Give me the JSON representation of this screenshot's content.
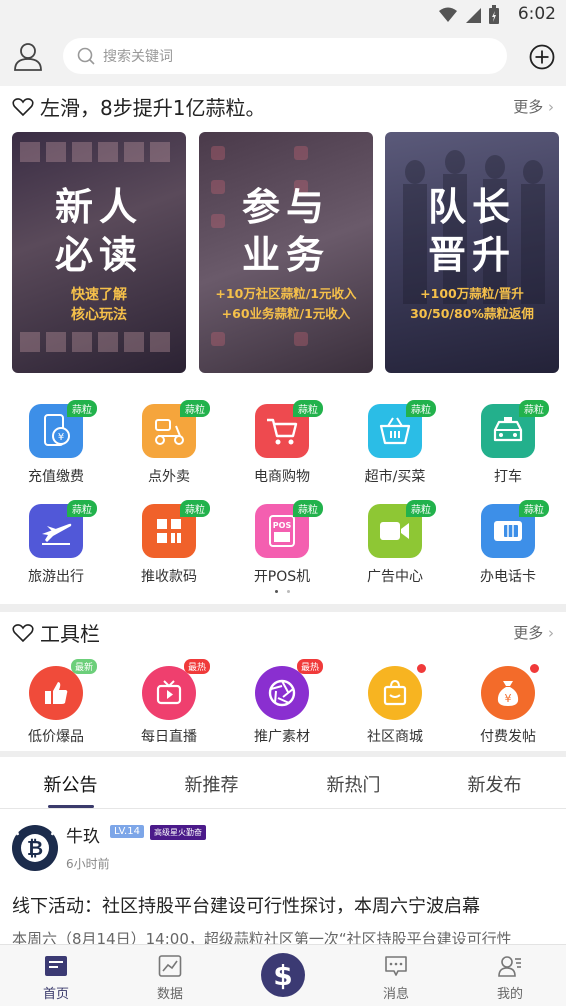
{
  "status": {
    "time": "6:02"
  },
  "search": {
    "placeholder": "搜索关键词"
  },
  "section1": {
    "title": "左滑，8步提升1亿蒜粒。",
    "more": "更多"
  },
  "banners": [
    {
      "big1": "新人",
      "big2": "必读",
      "sub1": "快速了解",
      "sub2": "核心玩法"
    },
    {
      "big1": "参与",
      "big2": "业务",
      "sub1": "+10万社区蒜粒/1元收入",
      "sub2": "+60业务蒜粒/1元收入"
    },
    {
      "big1": "队长",
      "big2": "晋升",
      "sub1": "+100万蒜粒/晋升",
      "sub2": "30/50/80%蒜粒返佣"
    }
  ],
  "grid_badge": "蒜粒",
  "grid": [
    {
      "label": "充值缴费",
      "icon": "phone-recharge-icon"
    },
    {
      "label": "点外卖",
      "icon": "scooter-icon"
    },
    {
      "label": "电商购物",
      "icon": "cart-icon"
    },
    {
      "label": "超市/买菜",
      "icon": "basket-icon"
    },
    {
      "label": "打车",
      "icon": "taxi-icon"
    },
    {
      "label": "旅游出行",
      "icon": "plane-icon"
    },
    {
      "label": "推收款码",
      "icon": "qr-code-icon"
    },
    {
      "label": "开POS机",
      "icon": "pos-icon"
    },
    {
      "label": "广告中心",
      "icon": "video-icon"
    },
    {
      "label": "办电话卡",
      "icon": "sim-card-icon"
    }
  ],
  "section2": {
    "title": "工具栏",
    "more": "更多"
  },
  "tools": [
    {
      "label": "低价爆品",
      "badge": "最新",
      "icon": "thumb-up-icon"
    },
    {
      "label": "每日直播",
      "badge": "最热",
      "icon": "live-tv-icon"
    },
    {
      "label": "推广素材",
      "badge": "最热",
      "icon": "aperture-icon"
    },
    {
      "label": "社区商城",
      "badge": "",
      "icon": "shopping-bag-icon"
    },
    {
      "label": "付费发帖",
      "badge": "",
      "icon": "money-bag-icon"
    }
  ],
  "tabs": [
    "新公告",
    "新推荐",
    "新热门",
    "新发布"
  ],
  "post": {
    "author": "牛玖",
    "level": "LV.14",
    "title_badge": "高级星火勤奋",
    "time": "6小时前",
    "title": "线下活动：社区持股平台建设可行性探讨，本周六宁波启幕",
    "excerpt": "本周六（8月14日）14:00，超级蒜粒社区第一次“社区持股平台建设可行性"
  },
  "nav": [
    {
      "label": "首页",
      "icon": "home-icon"
    },
    {
      "label": "数据",
      "icon": "chart-icon"
    },
    {
      "label": "",
      "icon": "dollar-icon"
    },
    {
      "label": "消息",
      "icon": "message-icon"
    },
    {
      "label": "我的",
      "icon": "profile-icon"
    }
  ],
  "colors": {
    "accent": "#3b3a73",
    "badge_green": "#22b24c",
    "badge_red": "#f03a3a"
  }
}
